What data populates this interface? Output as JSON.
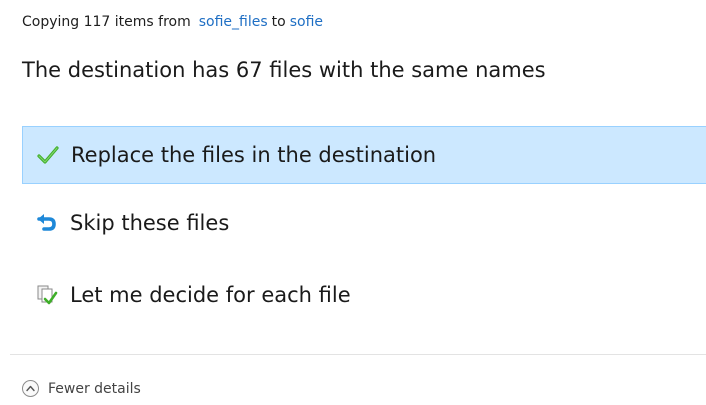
{
  "copy_status": {
    "prefix": "Copying 117 items from",
    "source": "sofie_files",
    "middle": "to",
    "destination": "sofie"
  },
  "heading": "The destination has 67 files with the same names",
  "options": [
    {
      "label": "Replace the files in the destination",
      "icon": "green-checkmark-icon",
      "selected": true
    },
    {
      "label": "Skip these files",
      "icon": "blue-skip-arrow-icon",
      "selected": false
    },
    {
      "label": "Let me decide for each file",
      "icon": "compare-files-icon",
      "selected": false
    }
  ],
  "details_toggle": {
    "label": "Fewer details",
    "icon": "chevron-up-icon"
  },
  "colors": {
    "link": "#1f6fc4",
    "selected_bg": "#cce8ff",
    "selected_border": "#99d1ff",
    "check_green": "#3fae29",
    "skip_blue": "#1e88d8"
  }
}
